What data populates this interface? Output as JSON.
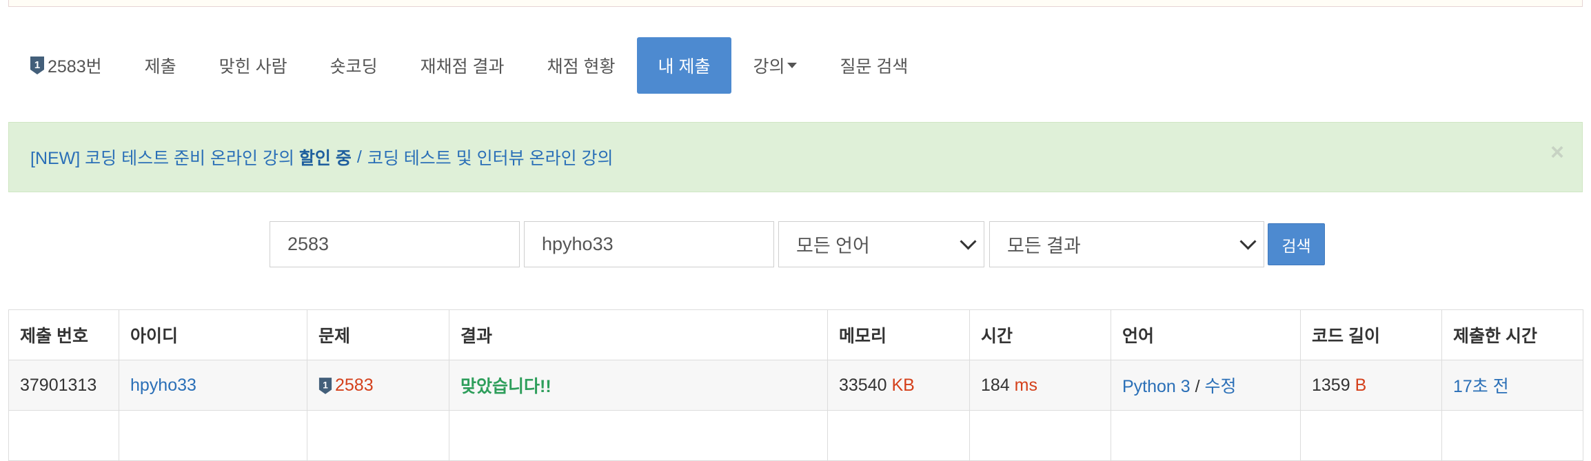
{
  "nav": {
    "problem_label": "2583번",
    "items": [
      "제출",
      "맞힌 사람",
      "숏코딩",
      "재채점 결과",
      "채점 현황",
      "내 제출",
      "강의",
      "질문 검색"
    ],
    "active_index": 5,
    "tier_icon": "silver-tier-1-icon",
    "tier_number": "1"
  },
  "alert": {
    "part1": "[NEW] 코딩 테스트 준비 온라인 강의 ",
    "part1_bold": "할인 중",
    "separator": "/",
    "part2": "코딩 테스트 및 인터뷰 온라인 강의",
    "close": "×"
  },
  "search": {
    "problem_value": "2583",
    "user_value": "hpyho33",
    "language_selected": "모든 언어",
    "result_selected": "모든 결과",
    "button_label": "검색"
  },
  "table": {
    "headers": [
      "제출 번호",
      "아이디",
      "문제",
      "결과",
      "메모리",
      "시간",
      "언어",
      "코드 길이",
      "제출한 시간"
    ],
    "rows": [
      {
        "submission_id": "37901313",
        "user": "hpyho33",
        "problem": "2583",
        "result": "맞았습니다!!",
        "memory": "33540",
        "memory_unit": "KB",
        "time": "184",
        "time_unit": "ms",
        "language": "Python 3",
        "lang_sep": "/",
        "edit": "수정",
        "code_length": "1359",
        "code_unit": "B",
        "submitted": "17초 전"
      }
    ]
  },
  "colors": {
    "accent": "#4d8ad0",
    "link": "#2a6fb7",
    "ok": "#2e9e5b",
    "unit_red": "#d4401b",
    "alert_bg": "#dff0d8"
  }
}
